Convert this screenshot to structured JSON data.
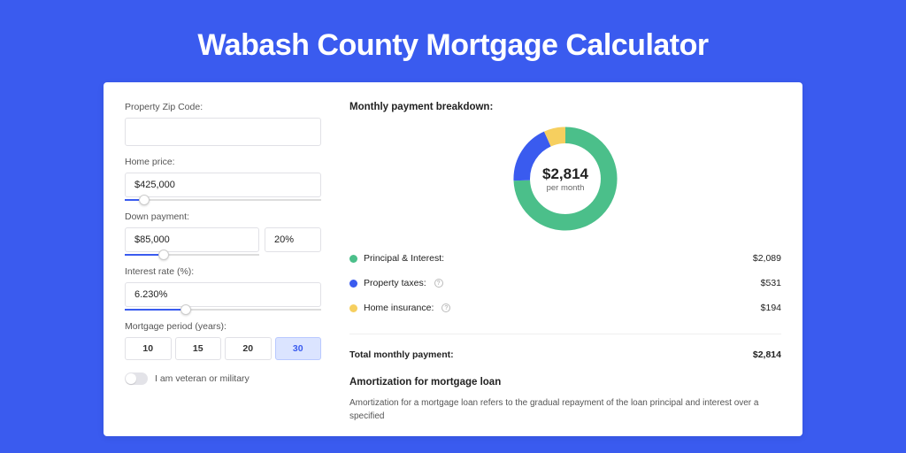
{
  "title": "Wabash County Mortgage Calculator",
  "form": {
    "zip_label": "Property Zip Code:",
    "zip_value": "",
    "home_price_label": "Home price:",
    "home_price_value": "$425,000",
    "down_payment_label": "Down payment:",
    "down_payment_value": "$85,000",
    "down_payment_pct": "20%",
    "interest_label": "Interest rate (%):",
    "interest_value": "6.230%",
    "period_label": "Mortgage period (years):",
    "period_options": [
      "10",
      "15",
      "20",
      "30"
    ],
    "period_selected": "30",
    "veteran_label": "I am veteran or military",
    "veteran_on": false
  },
  "breakdown": {
    "title": "Monthly payment breakdown:",
    "center_amount": "$2,814",
    "center_sub": "per month",
    "rows": [
      {
        "label": "Principal & Interest:",
        "value": "$2,089",
        "color": "green",
        "info": false
      },
      {
        "label": "Property taxes:",
        "value": "$531",
        "color": "blue",
        "info": true
      },
      {
        "label": "Home insurance:",
        "value": "$194",
        "color": "yellow",
        "info": true
      }
    ],
    "total_label": "Total monthly payment:",
    "total_value": "$2,814"
  },
  "amortization": {
    "title": "Amortization for mortgage loan",
    "text": "Amortization for a mortgage loan refers to the gradual repayment of the loan principal and interest over a specified"
  },
  "chart_data": {
    "type": "pie",
    "title": "Monthly payment breakdown",
    "series": [
      {
        "name": "Principal & Interest",
        "value": 2089,
        "color": "#4bbf8a"
      },
      {
        "name": "Property taxes",
        "value": 531,
        "color": "#3a5bef"
      },
      {
        "name": "Home insurance",
        "value": 194,
        "color": "#f6cf5f"
      }
    ],
    "total": 2814,
    "unit": "USD per month"
  }
}
